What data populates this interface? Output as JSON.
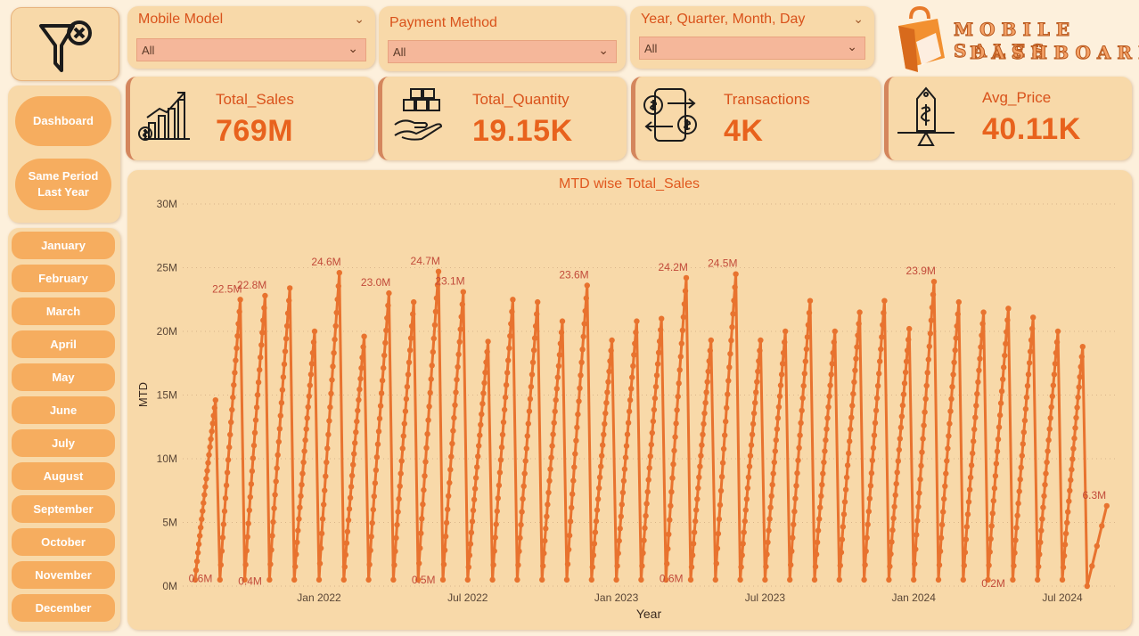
{
  "filters": [
    {
      "title": "Mobile Model",
      "value": "All"
    },
    {
      "title": "Payment Method",
      "value": "All"
    },
    {
      "title": "Year, Quarter, Month, Day",
      "value": "All"
    }
  ],
  "logo": {
    "line1": "MOBILE SALES",
    "line2": "DASHBOARD"
  },
  "nav": {
    "dashboard": "Dashboard",
    "same_period_1": "Same Period",
    "same_period_2": "Last Year"
  },
  "months": [
    "January",
    "February",
    "March",
    "April",
    "May",
    "June",
    "July",
    "August",
    "September",
    "October",
    "November",
    "December"
  ],
  "kpis": [
    {
      "label": "Total_Sales",
      "value": "769M",
      "icon": "sales-growth-icon"
    },
    {
      "label": "Total_Quantity",
      "value": "19.15K",
      "icon": "boxes-hand-icon"
    },
    {
      "label": "Transactions",
      "value": "4K",
      "icon": "money-transfer-icon"
    },
    {
      "label": "Avg_Price",
      "value": "40.11K",
      "icon": "price-balance-icon"
    }
  ],
  "colors": {
    "accent": "#e8621d",
    "line": "#e8732f",
    "card": "#f8d9a9",
    "page": "#fdf0dc",
    "label": "#c24b3a"
  },
  "chart_data": {
    "type": "line",
    "title": "MTD wise Total_Sales",
    "xlabel": "Year",
    "ylabel": "MTD",
    "y_ticks": [
      "0M",
      "5M",
      "10M",
      "15M",
      "20M",
      "25M",
      "30M"
    ],
    "ylim": [
      0,
      30
    ],
    "x_ticks": [
      {
        "label": "Jan 2022",
        "month_index": 5
      },
      {
        "label": "Jul 2022",
        "month_index": 11
      },
      {
        "label": "Jan 2023",
        "month_index": 17
      },
      {
        "label": "Jul 2023",
        "month_index": 23
      },
      {
        "label": "Jan 2024",
        "month_index": 29
      },
      {
        "label": "Jul 2024",
        "month_index": 35
      }
    ],
    "grid": true,
    "series": [
      {
        "unit": "M",
        "month_end_values": [
          14.6,
          22.5,
          22.8,
          23.4,
          20.0,
          24.6,
          19.6,
          23.0,
          22.3,
          24.7,
          23.1,
          19.2,
          22.5,
          22.3,
          20.8,
          23.6,
          19.3,
          20.8,
          21.0,
          24.2,
          19.3,
          24.5,
          19.3,
          20.0,
          22.4,
          20.0,
          21.5,
          22.4,
          20.2,
          23.9,
          22.3,
          21.5,
          21.8,
          21.1,
          20.0,
          18.8,
          6.3
        ]
      }
    ],
    "data_labels": [
      {
        "text": "0.6M",
        "month_index": 0,
        "pos": "start"
      },
      {
        "text": "22.5M",
        "month_index": 1,
        "pos": "end"
      },
      {
        "text": "0.4M",
        "month_index": 2,
        "pos": "start"
      },
      {
        "text": "22.8M",
        "month_index": 2,
        "pos": "end"
      },
      {
        "text": "24.6M",
        "month_index": 5,
        "pos": "end"
      },
      {
        "text": "23.0M",
        "month_index": 7,
        "pos": "end"
      },
      {
        "text": "24.7M",
        "month_index": 9,
        "pos": "end"
      },
      {
        "text": "0.5M",
        "month_index": 9,
        "pos": "start"
      },
      {
        "text": "23.1M",
        "month_index": 10,
        "pos": "end"
      },
      {
        "text": "23.6M",
        "month_index": 15,
        "pos": "end"
      },
      {
        "text": "0.6M",
        "month_index": 19,
        "pos": "start"
      },
      {
        "text": "24.2M",
        "month_index": 19,
        "pos": "end"
      },
      {
        "text": "24.5M",
        "month_index": 21,
        "pos": "end"
      },
      {
        "text": "23.9M",
        "month_index": 29,
        "pos": "end"
      },
      {
        "text": "0.2M",
        "month_index": 32,
        "pos": "start"
      },
      {
        "text": "6.3M",
        "month_index": 36,
        "pos": "end"
      }
    ]
  }
}
